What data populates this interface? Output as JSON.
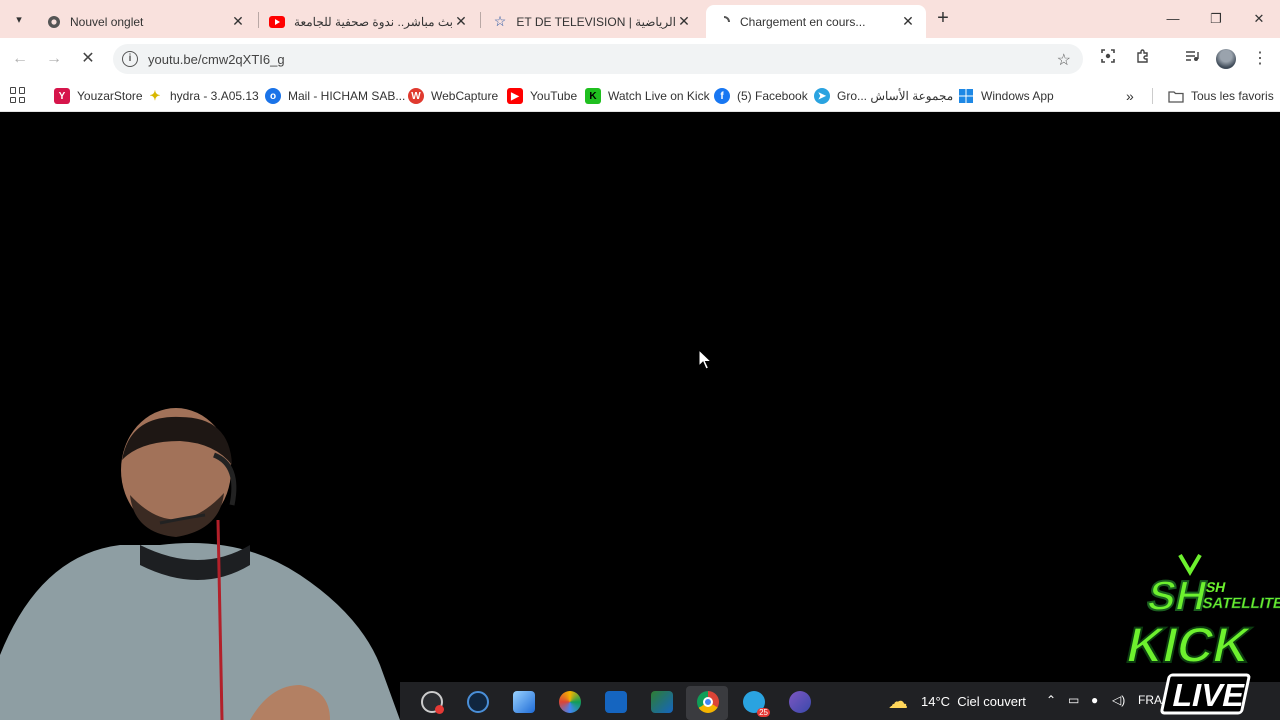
{
  "tabs": [
    {
      "title": "Nouvel onglet",
      "icon": "chrome-icon"
    },
    {
      "title": "بث مباشر.. ندوة صحفية للجامعة",
      "icon": "youtube-icon"
    },
    {
      "title": "الرياضية | ON ET DE TELEVISION",
      "icon": "star-icon"
    },
    {
      "title": "Chargement en cours...",
      "icon": "loading-icon",
      "active": true
    }
  ],
  "address_bar": {
    "url": "youtu.be/cmw2qXTI6_g"
  },
  "bookmarks": [
    {
      "label": "YouzarStore",
      "icon": "youzar-icon",
      "color": "#d6154b"
    },
    {
      "label": "hydra - 3.A05.13",
      "icon": "hydra-icon",
      "color": "#d8b700"
    },
    {
      "label": "Mail - HICHAM SAB...",
      "icon": "outlook-icon",
      "color": "#1a73e8"
    },
    {
      "label": "WebCapture",
      "icon": "webcapture-icon",
      "color": "#e03a2f"
    },
    {
      "label": "YouTube",
      "icon": "youtube-icon",
      "color": "#ff0000"
    },
    {
      "label": "Watch Live on Kick",
      "icon": "kick-icon",
      "color": "#1fbf1f"
    },
    {
      "label": "(5) Facebook",
      "icon": "facebook-icon",
      "color": "#1877f2"
    },
    {
      "label": "Gro... مجموعة الأساش",
      "icon": "telegram-icon",
      "color": "#2aa3e0"
    },
    {
      "label": "Windows App",
      "icon": "windows-icon",
      "color": "#1e88e5"
    }
  ],
  "all_bookmarks": "Tous les favoris",
  "taskbar": {
    "weather_temp": "14°C",
    "weather_text": "Ciel couvert",
    "language": "FRA",
    "telegram_badge": "25"
  },
  "overlay_logo": {
    "line1": "SH",
    "line2": "SATELLITE",
    "line3": "KICK",
    "line4": "LIVE"
  }
}
